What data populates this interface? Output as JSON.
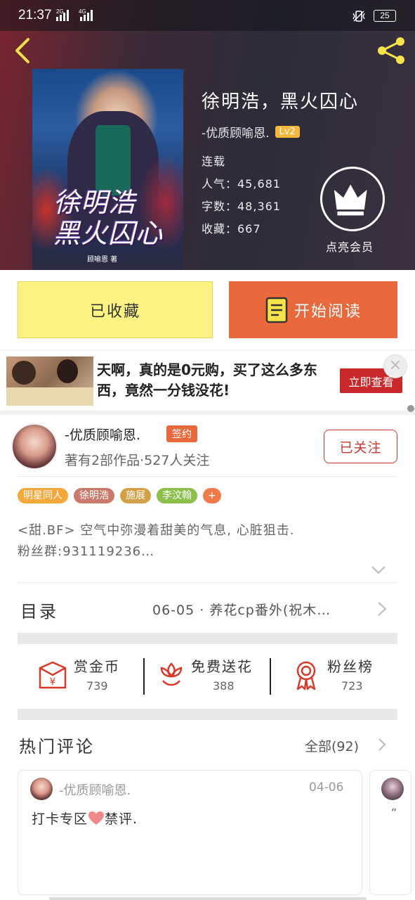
{
  "statusbar": {
    "time": "21:37",
    "net1": "2G",
    "net2": "4G",
    "battery": "25"
  },
  "book": {
    "title": "徐明浩，黑火囚心",
    "cover_title_line1": "徐明浩",
    "cover_title_line2": "黑火囚心",
    "cover_author": "顾喻恩 著",
    "author": "-优质顾喻恩.",
    "level": "Lv2",
    "status": "连载",
    "popularity": "人气：45,681",
    "word_count": "字数：48,361",
    "favorites": "收藏：667"
  },
  "vip": {
    "label": "点亮会员"
  },
  "actions": {
    "collected": "已收藏",
    "read": "开始阅读"
  },
  "ad": {
    "text": "天啊，真的是0元购，买了这么多东西，竟然一分钱没花!",
    "cta": "立即查看",
    "close": "×"
  },
  "author_info": {
    "name": "-优质顾喻恩.",
    "badge": "签约",
    "stats": "著有2部作品·527人关注",
    "follow": "已关注"
  },
  "tags": [
    {
      "label": "明星同人",
      "color": "#f5a83a"
    },
    {
      "label": "徐明浩",
      "color": "#c97a6a"
    },
    {
      "label": "施展",
      "color": "#d4a046"
    },
    {
      "label": "李汶翰",
      "color": "#8cc04a"
    },
    {
      "label": "+",
      "color": "#f07a4a"
    }
  ],
  "description": {
    "line1": "<甜.BF> 空气中弥漫着甜美的气息, 心脏狙击.",
    "line2": "粉丝群:931119236…"
  },
  "toc": {
    "label": "目录",
    "latest": "06-05 · 养花cp番外(祝木…"
  },
  "stats": [
    {
      "label": "赏金币",
      "value": "739",
      "icon": "red-envelope-icon"
    },
    {
      "label": "免费送花",
      "value": "388",
      "icon": "flower-icon"
    },
    {
      "label": "粉丝榜",
      "value": "723",
      "icon": "medal-icon"
    }
  ],
  "comments": {
    "title": "热门评论",
    "all": "全部(92)",
    "items": [
      {
        "user": "-优质顾喻恩.",
        "date": "04-06",
        "text_before": "打卡专区",
        "text_after": "禁评."
      }
    ]
  },
  "colors": {
    "accent": "#e9683c",
    "follow_red": "#c7372e",
    "collected_yellow": "#fdf383"
  }
}
